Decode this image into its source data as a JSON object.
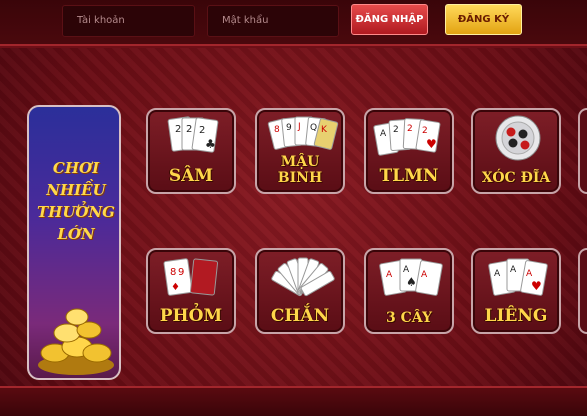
{
  "login": {
    "username_placeholder": "Tài khoản",
    "password_placeholder": "Mật khẩu",
    "login_label": "ĐĂNG NHẬP",
    "register_label": "ĐĂNG KÝ"
  },
  "promo": {
    "line1": "CHƠI NHIỀU",
    "line2": "THƯỞNG LỚN"
  },
  "games": [
    {
      "label": "SÂM"
    },
    {
      "label": "MẬU BINH"
    },
    {
      "label": "TLMN"
    },
    {
      "label": "XÓC ĐĨA"
    },
    {
      "label": "PHỎM"
    },
    {
      "label": "CHẮN"
    },
    {
      "label": "3 CÂY"
    },
    {
      "label": "LIÊNG"
    }
  ],
  "colors": {
    "background": "#6e0f17",
    "label_gold": "#ffd64a",
    "login_button": "#d9343a",
    "register_button": "#f2c030"
  }
}
